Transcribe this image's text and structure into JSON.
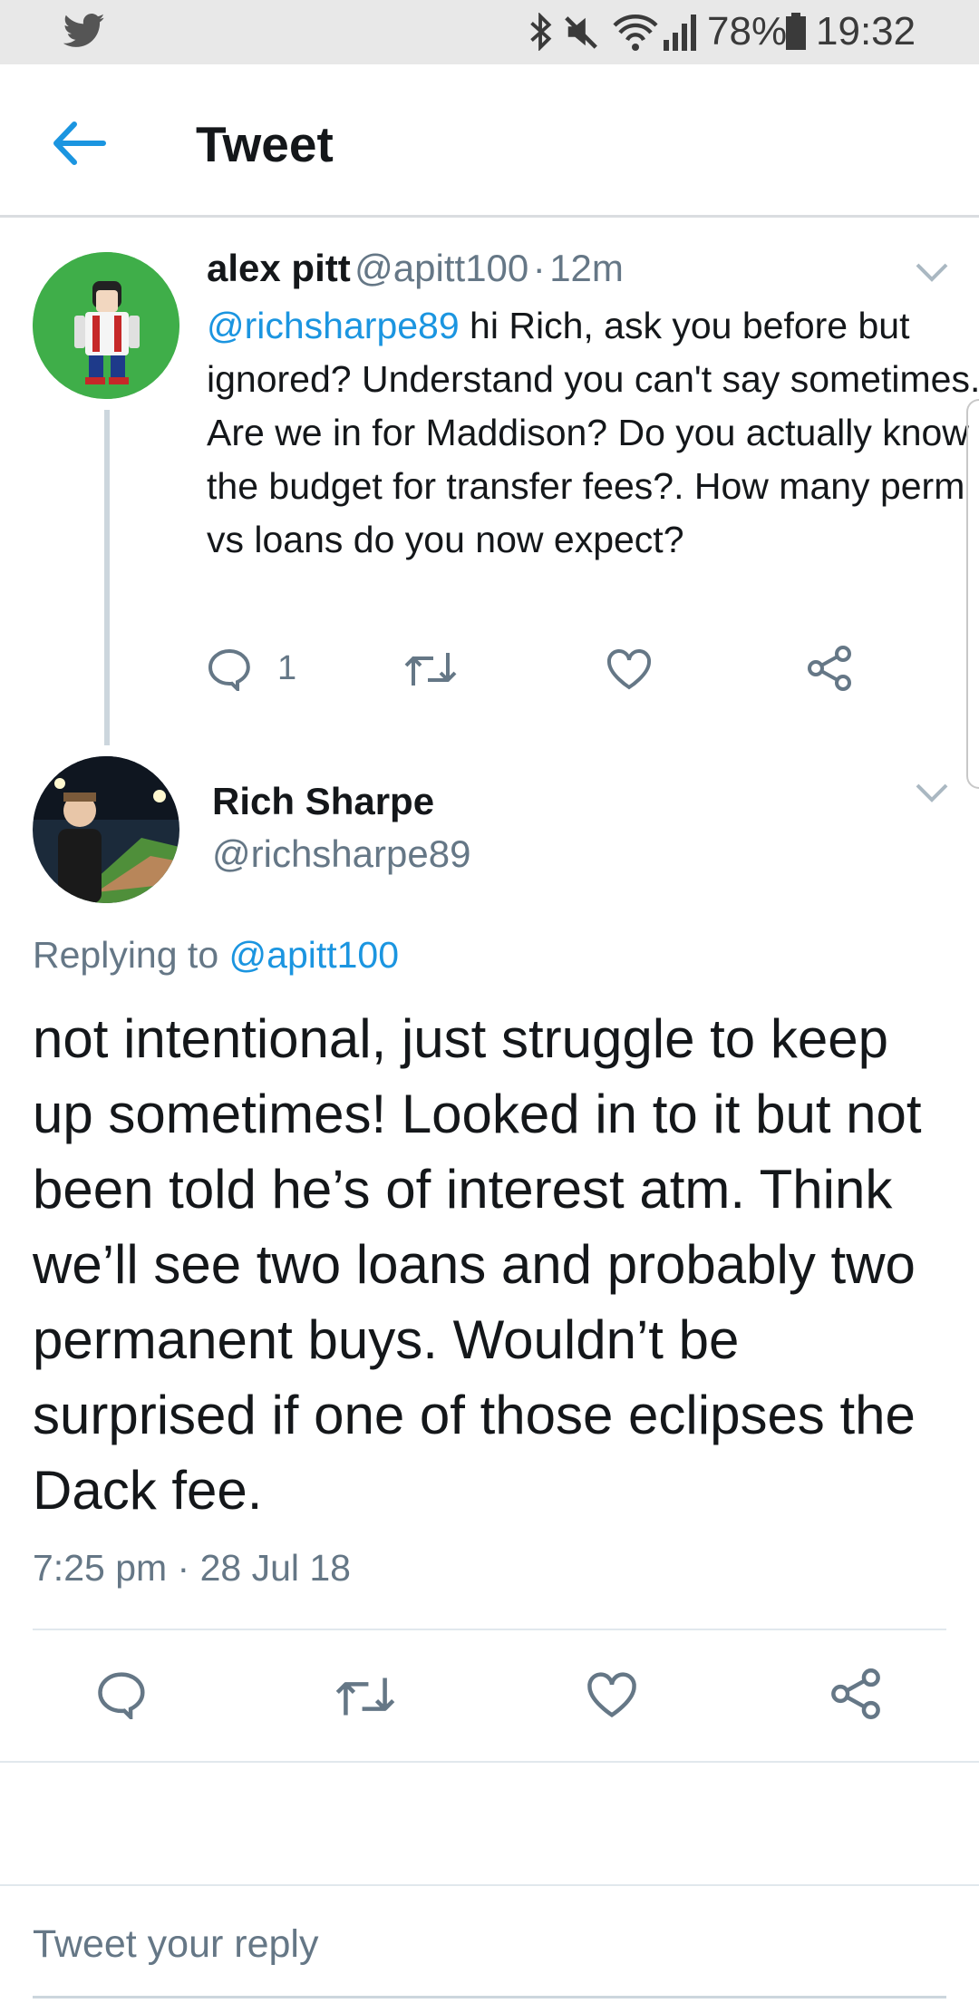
{
  "status_bar": {
    "battery": "78%",
    "time": "19:32",
    "icons": [
      "twitter-bird-icon",
      "bluetooth-icon",
      "mute-icon",
      "wifi-icon",
      "signal-icon",
      "battery-icon"
    ]
  },
  "header": {
    "title": "Tweet",
    "back_icon": "back-arrow-icon"
  },
  "parent_tweet": {
    "name": "alex pitt",
    "handle": "@apitt100",
    "separator": "·",
    "time": "12m",
    "mention": "@richsharpe89",
    "text": " hi Rich, ask you before but ignored? Understand you can't say sometimes. Are we in for Maddison? Do you actually know the budget for transfer fees?. How many perm vs loans do you now expect?",
    "reply_count": "1",
    "actions": [
      "reply-icon",
      "retweet-icon",
      "like-icon",
      "share-icon"
    ]
  },
  "main_tweet": {
    "name": "Rich Sharpe",
    "handle": "@richsharpe89",
    "replying_prefix": "Replying to ",
    "replying_handle": "@apitt100",
    "text": "not intentional, just struggle to keep up sometimes! Looked in to it but not been told he’s of interest atm. Think we’ll see two loans and probably two permanent buys. Wouldn’t be surprised if one of those eclipses the Dack fee.",
    "timestamp": "7:25 pm · 28 Jul 18",
    "actions": [
      "reply-icon",
      "retweet-icon",
      "like-icon",
      "share-icon"
    ]
  },
  "reply_box": {
    "placeholder": "Tweet your reply"
  },
  "colors": {
    "accent": "#1b95e0",
    "muted": "#657786",
    "divider": "#e1e8ed",
    "status_bar": "#e8e8e8"
  }
}
